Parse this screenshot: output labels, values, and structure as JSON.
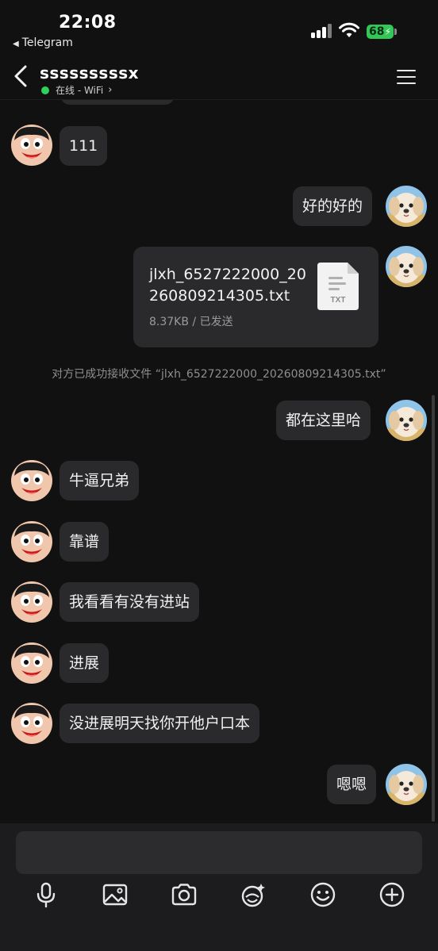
{
  "status_bar": {
    "time": "22:08",
    "back_app": "Telegram",
    "battery": "68"
  },
  "header": {
    "contact_name": "sssssssssx",
    "presence": "在线 - WiFi"
  },
  "messages": [
    {
      "side": "left",
      "text": "111"
    },
    {
      "side": "right",
      "text": "好的好的"
    },
    {
      "side": "right",
      "type": "file",
      "file_name": "jlxh_6527222000_20260809214305.txt",
      "file_meta": "8.37KB / 已发送",
      "file_ext": "TXT"
    },
    {
      "type": "system",
      "text": "对方已成功接收文件 “jlxh_6527222000_20260809214305.txt”"
    },
    {
      "side": "right",
      "text": "都在这里哈"
    },
    {
      "side": "left",
      "text": "牛逼兄弟"
    },
    {
      "side": "left",
      "text": "靠谱"
    },
    {
      "side": "left",
      "text": "我看看有没有进站"
    },
    {
      "side": "left",
      "text": "进展"
    },
    {
      "side": "left",
      "text": "没进展明天找你开他户口本"
    },
    {
      "side": "right",
      "text": "嗯嗯"
    }
  ],
  "composer": {
    "input_value": "",
    "toolbar_icons": [
      "microphone-icon",
      "image-icon",
      "camera-icon",
      "sticker-icon",
      "emoji-icon",
      "plus-icon"
    ]
  },
  "colors": {
    "background": "#111111",
    "bubble": "#2a2a2c",
    "online": "#30d158",
    "battery": "#33c758"
  }
}
